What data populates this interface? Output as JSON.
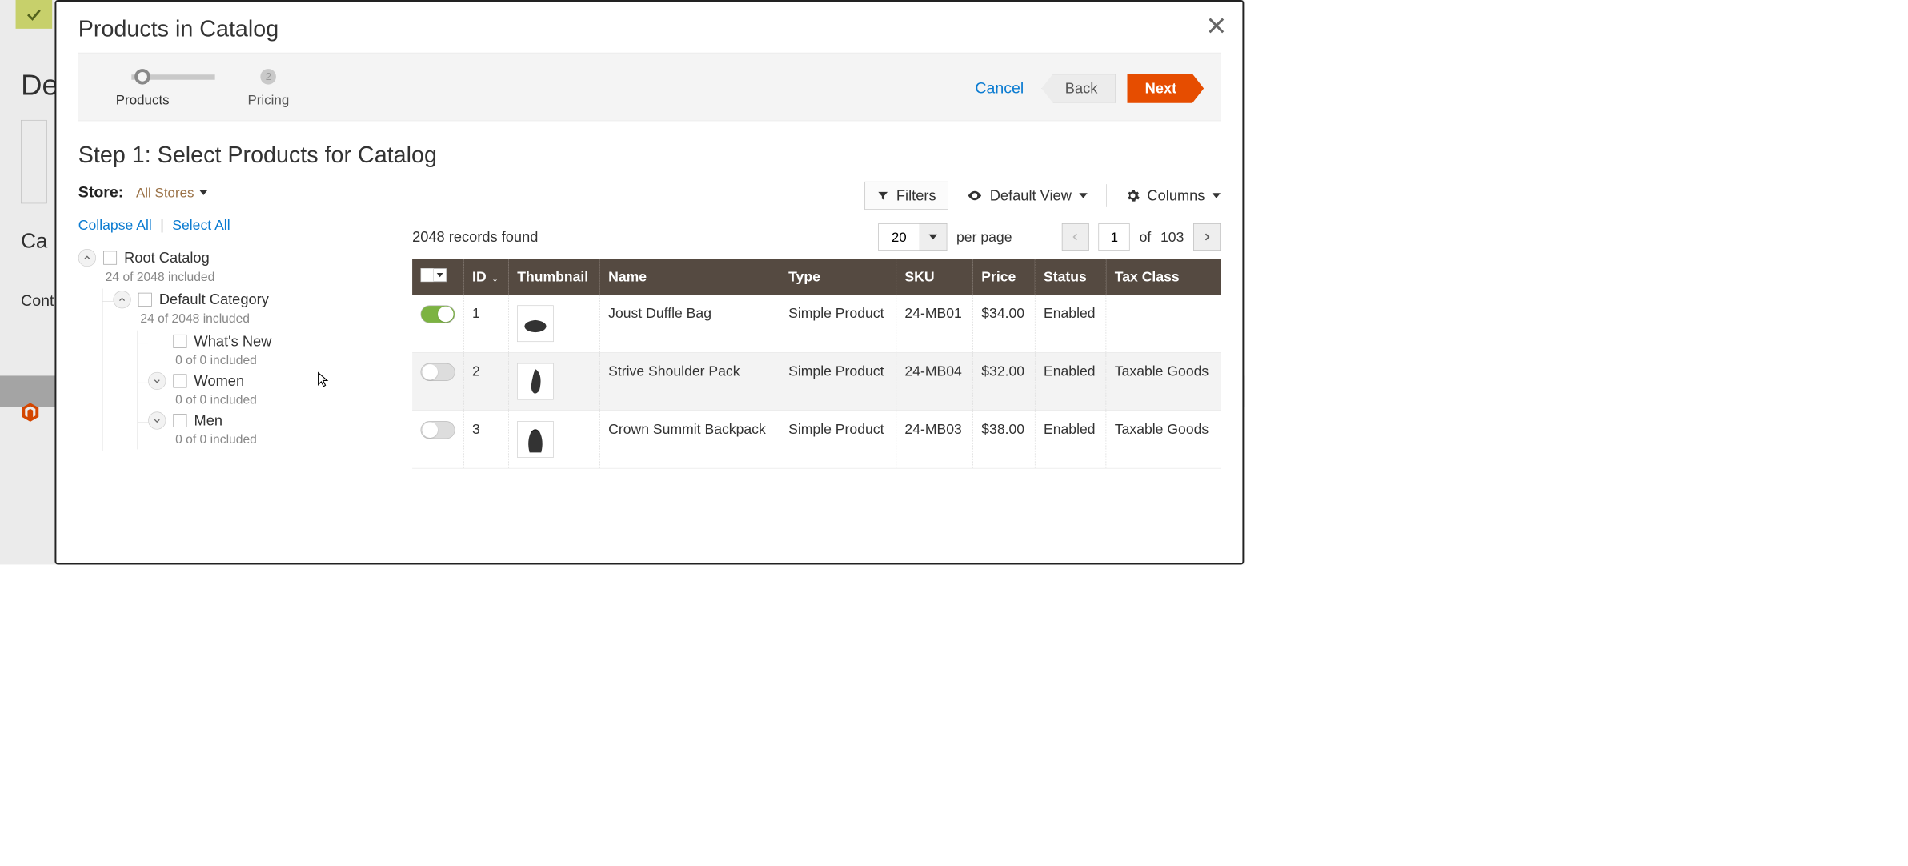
{
  "background": {
    "de": "De",
    "ca": "Ca",
    "cont": "Cont"
  },
  "modal": {
    "title": "Products in Catalog",
    "wizard": {
      "steps": [
        {
          "key": "products",
          "label": "Products"
        },
        {
          "key": "pricing",
          "label": "Pricing",
          "number": "2"
        }
      ],
      "cancel": "Cancel",
      "back": "Back",
      "next": "Next"
    },
    "step_heading": "Step 1: Select Products for Catalog",
    "store": {
      "label": "Store:",
      "selected": "All Stores"
    },
    "tree_actions": {
      "collapse_all": "Collapse All",
      "select_all": "Select All"
    },
    "tree": {
      "root": {
        "name": "Root Catalog",
        "count": "24 of 2048 included",
        "children": {
          "default": {
            "name": "Default Category",
            "count": "24 of 2048 included",
            "children": {
              "whatsnew": {
                "name": "What's New",
                "count": "0 of 0 included"
              },
              "women": {
                "name": "Women",
                "count": "0 of 0 included"
              },
              "men": {
                "name": "Men",
                "count": "0 of 0 included"
              }
            }
          }
        }
      }
    },
    "toolbar": {
      "filters": "Filters",
      "default_view": "Default View",
      "columns": "Columns"
    },
    "list": {
      "records_found": "2048 records found",
      "page_size": "20",
      "per_page_label": "per page",
      "current_page": "1",
      "of_label": "of",
      "total_pages": "103"
    },
    "grid": {
      "columns": {
        "id": "ID",
        "thumbnail": "Thumbnail",
        "name": "Name",
        "type": "Type",
        "sku": "SKU",
        "price": "Price",
        "status": "Status",
        "tax": "Tax Class"
      },
      "rows": [
        {
          "selected": true,
          "id": "1",
          "name": "Joust Duffle Bag",
          "type": "Simple Product",
          "sku": "24-MB01",
          "price": "$34.00",
          "status": "Enabled",
          "tax": ""
        },
        {
          "selected": false,
          "id": "2",
          "name": "Strive Shoulder Pack",
          "type": "Simple Product",
          "sku": "24-MB04",
          "price": "$32.00",
          "status": "Enabled",
          "tax": "Taxable Goods"
        },
        {
          "selected": false,
          "id": "3",
          "name": "Crown Summit Backpack",
          "type": "Simple Product",
          "sku": "24-MB03",
          "price": "$38.00",
          "status": "Enabled",
          "tax": "Taxable Goods"
        }
      ]
    }
  }
}
